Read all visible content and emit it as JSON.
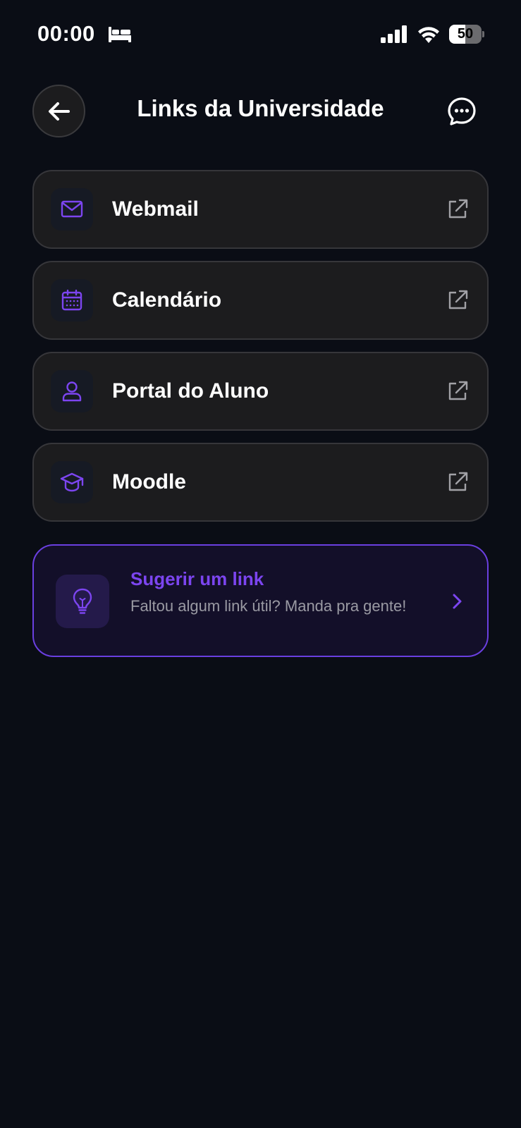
{
  "status_bar": {
    "time": "00:00",
    "battery_level": "50",
    "battery_percent": 50
  },
  "header": {
    "title": "Links da Universidade",
    "back_icon": "arrow-left-icon",
    "chat_icon": "chat-bubble-icon"
  },
  "links": [
    {
      "label": "Webmail",
      "icon": "mail-icon"
    },
    {
      "label": "Calendário",
      "icon": "calendar-icon"
    },
    {
      "label": "Portal do Aluno",
      "icon": "user-icon"
    },
    {
      "label": "Moodle",
      "icon": "graduation-cap-icon"
    }
  ],
  "suggest": {
    "title": "Sugerir um link",
    "description": "Faltou algum link útil? Manda pra gente!",
    "icon": "lightbulb-icon"
  },
  "colors": {
    "background": "#0a0d15",
    "card": "#1c1c1e",
    "accent": "#7c45f0"
  }
}
